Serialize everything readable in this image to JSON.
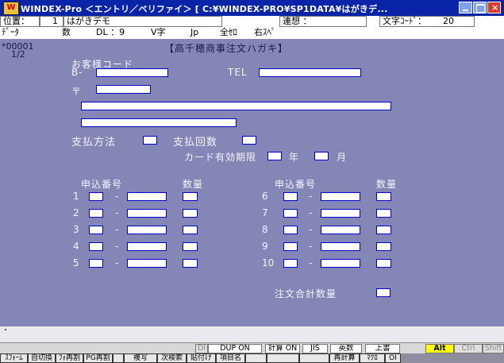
{
  "window": {
    "title": "WINDEX-Pro ＜エントリ／ベリファイ＞ [ C:¥WINDEX-PRO¥SP1DATA¥はがきデ..."
  },
  "info1": {
    "pos_label": "位置：",
    "pos_value": "1",
    "doc_name": "はがきデモ",
    "assoc_label": "連想 ：",
    "char_code_label": "文字ｺｰﾄﾞ：",
    "char_code_value": "20"
  },
  "info2": {
    "data_label": "ﾃﾞｰﾀ",
    "count_label": "数",
    "dl_label": "DL ：9",
    "vchar_label": "V字",
    "jp_label": "Jp",
    "zenkaku_label": "全ｾﾛ",
    "right_space_label": "右ｽﾍﾟ"
  },
  "record": {
    "number": "*00001",
    "page": "1/2"
  },
  "form": {
    "title": "【高千穂商事注文ハガキ】",
    "customer_code_label": "お客様コード",
    "b_label": "B-",
    "tel_label": "TEL",
    "postal_label": "〒",
    "payment_method_label": "支払方法",
    "payment_count_label": "支払回数",
    "card_expiry_label": "カード有効期限",
    "year_label": "年",
    "month_label": "月",
    "order_no_header": "申込番号",
    "qty_header": "数量",
    "order_no_header_r": "申込番号",
    "qty_header_r": "数量",
    "dash": "-",
    "rows_left": [
      "1",
      "2",
      "3",
      "4",
      "5"
    ],
    "rows_right": [
      "6",
      "7",
      "8",
      "9",
      "10"
    ],
    "total_label": "注文合計数量"
  },
  "status": {
    "di": "DI",
    "dup": "DUP ON",
    "calc": "計算 ON",
    "jis": "JIS",
    "eisu": "英数",
    "ue": "上書",
    "alt": "Alt",
    "ctrl": "Ctrl",
    "shift": "Shift"
  },
  "fkeys": [
    "ｽﾌｫｰﾑ",
    "自切換",
    "ﾌｫ再割",
    "PG再割",
    "",
    "複写",
    "次検索",
    "貼付け",
    "項目名",
    "",
    "",
    "",
    "再計算",
    "ﾏｸﾛ",
    "OI"
  ]
}
